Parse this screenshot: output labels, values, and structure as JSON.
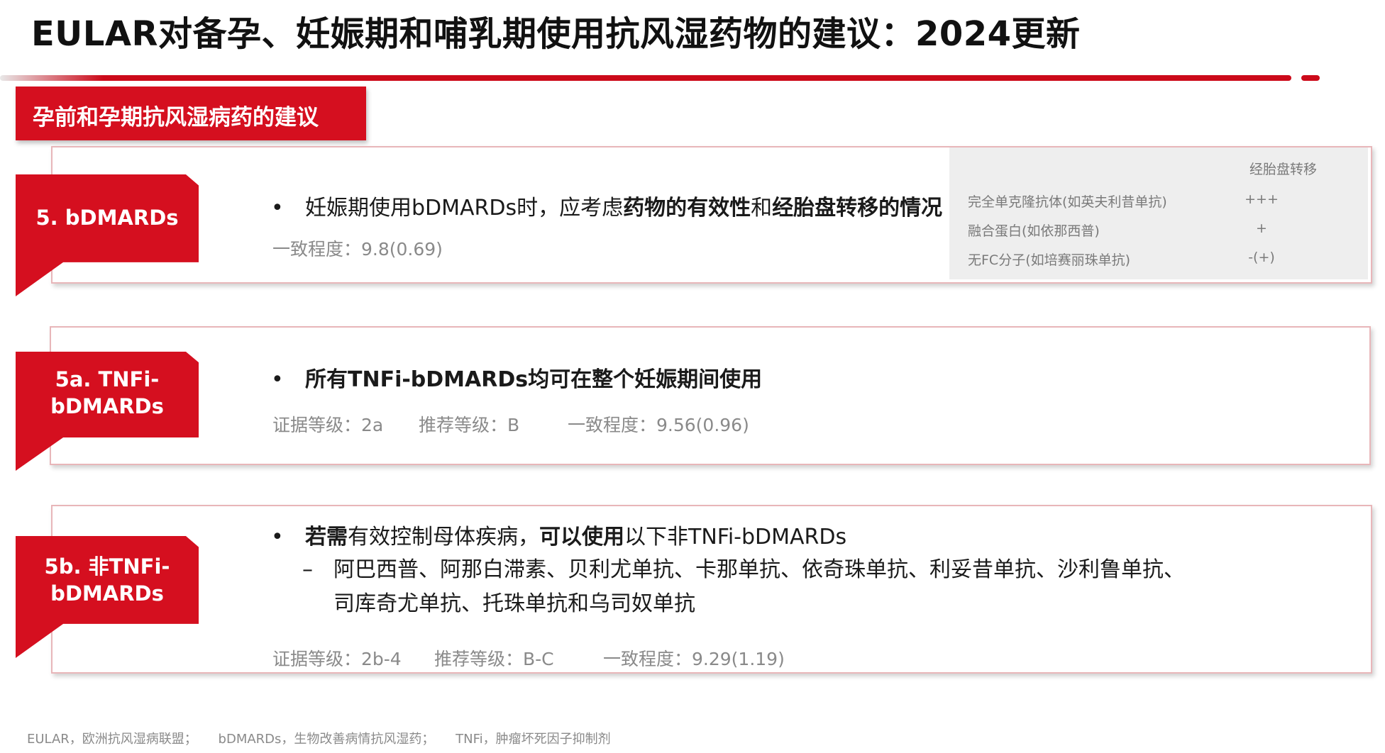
{
  "title": "EULAR对备孕、妊娠期和哺乳期使用抗风湿药物的建议：2024更新",
  "section_label": "孕前和孕期抗风湿病药的建议",
  "brand_color": "#d50f1f",
  "cards": [
    {
      "tag_lines": [
        "5. bDMARDs"
      ],
      "bullet": {
        "prefix": "妊娠期使用bDMARDs时，应考虑",
        "bold1": "药物的有效性",
        "mid": "和",
        "bold2": "经胎盘转移的情况"
      },
      "consensus": "一致程度：9.8(0.69)",
      "transfer_table": {
        "header": "经胎盘转移",
        "rows": [
          {
            "name": "完全单克隆抗体(如英夫利昔单抗)",
            "value": "+++"
          },
          {
            "name": "融合蛋白(如依那西普)",
            "value": "+"
          },
          {
            "name": "无FC分子(如培赛丽珠单抗)",
            "value": "-(+)"
          }
        ]
      }
    },
    {
      "tag_lines": [
        "5a. TNFi-",
        "bDMARDs"
      ],
      "bullet": "所有TNFi-bDMARDs均可在整个妊娠期间使用",
      "evidence": "证据等级：2a",
      "recommendation": "推荐等级：B",
      "consensus": "一致程度：9.56(0.96)"
    },
    {
      "tag_lines": [
        "5b. 非TNFi-",
        "bDMARDs"
      ],
      "bullet": {
        "bold1": "若需",
        "mid1": "有效控制母体疾病，",
        "bold2": "可以使用",
        "rest": "以下非TNFi-bDMARDs"
      },
      "drugs_line1": "阿巴西普、阿那白滞素、贝利尤单抗、卡那单抗、依奇珠单抗、利妥昔单抗、沙利鲁单抗、",
      "drugs_line2": "司库奇尤单抗、托珠单抗和乌司奴单抗",
      "dash": "–",
      "evidence": "证据等级：2b-4",
      "recommendation": "推荐等级：B-C",
      "consensus": "一致程度：9.29(1.19)"
    }
  ],
  "bullet_symbol": "•",
  "footnotes": [
    "EULAR，欧洲抗风湿病联盟；",
    "bDMARDs，生物改善病情抗风湿药；",
    "TNFi，肿瘤坏死因子抑制剂"
  ]
}
